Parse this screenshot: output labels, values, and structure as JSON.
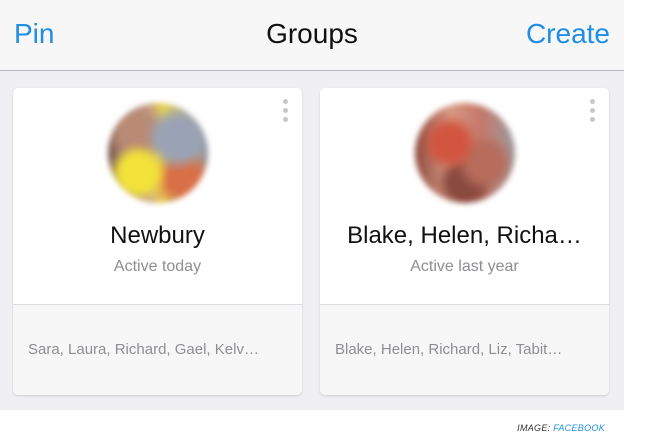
{
  "navbar": {
    "left_label": "Pin",
    "title": "Groups",
    "right_label": "Create"
  },
  "groups": [
    {
      "name": "Newbury",
      "status": "Active today",
      "members": "Sara, Laura, Richard, Gael, Kelv…"
    },
    {
      "name": "Blake, Helen, Richa…",
      "status": "Active last year",
      "members": "Blake, Helen, Richard, Liz, Tabit…"
    }
  ],
  "credit": {
    "prefix": "IMAGE: ",
    "source": "FACEBOOK"
  },
  "colors": {
    "accent": "#1f8ee6",
    "background": "#efeff4",
    "card": "#ffffff"
  },
  "icons": {
    "more": "vertical-ellipsis-icon",
    "avatar": "group-avatar"
  }
}
